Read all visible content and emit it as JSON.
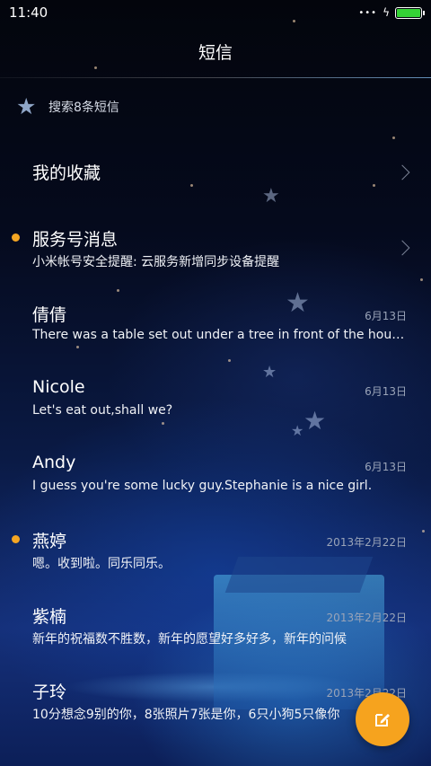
{
  "status_bar": {
    "time": "11:40",
    "signal": "•••",
    "charging": "ϟ",
    "battery_level": 1.0,
    "battery_color": "#35d335"
  },
  "header": {
    "title": "短信"
  },
  "search": {
    "label": "搜索8条短信"
  },
  "favorites": {
    "label": "我的收藏"
  },
  "service": {
    "name": "服务号消息",
    "preview": "小米帐号安全提醒: 云服务新增同步设备提醒",
    "unread": true
  },
  "conversations": [
    {
      "name": "倩倩",
      "date": "6月13日",
      "preview": "There was a table set out under a tree in front of the house",
      "unread": false
    },
    {
      "name": "Nicole",
      "date": "6月13日",
      "preview": "Let's eat out,shall we?",
      "unread": false
    },
    {
      "name": "Andy",
      "date": "6月13日",
      "preview": "I guess you're some lucky guy.Stephanie is a nice girl.",
      "unread": false
    },
    {
      "name": "燕婷",
      "date": "2013年2月22日",
      "preview": "嗯。收到啦。同乐同乐。",
      "unread": true
    },
    {
      "name": "紫楠",
      "date": "2013年2月22日",
      "preview": "新年的祝福数不胜数，新年的愿望好多好多，新年的问候",
      "unread": false
    },
    {
      "name": "子玲",
      "date": "2013年2月22日",
      "preview": "10分想念9别的你，8张照片7张是你，6只小狗5只像你",
      "unread": false
    }
  ],
  "fab": {
    "icon": "compose-icon"
  },
  "colors": {
    "accent": "#f6a31e",
    "unread_dot": "#f5a623"
  }
}
